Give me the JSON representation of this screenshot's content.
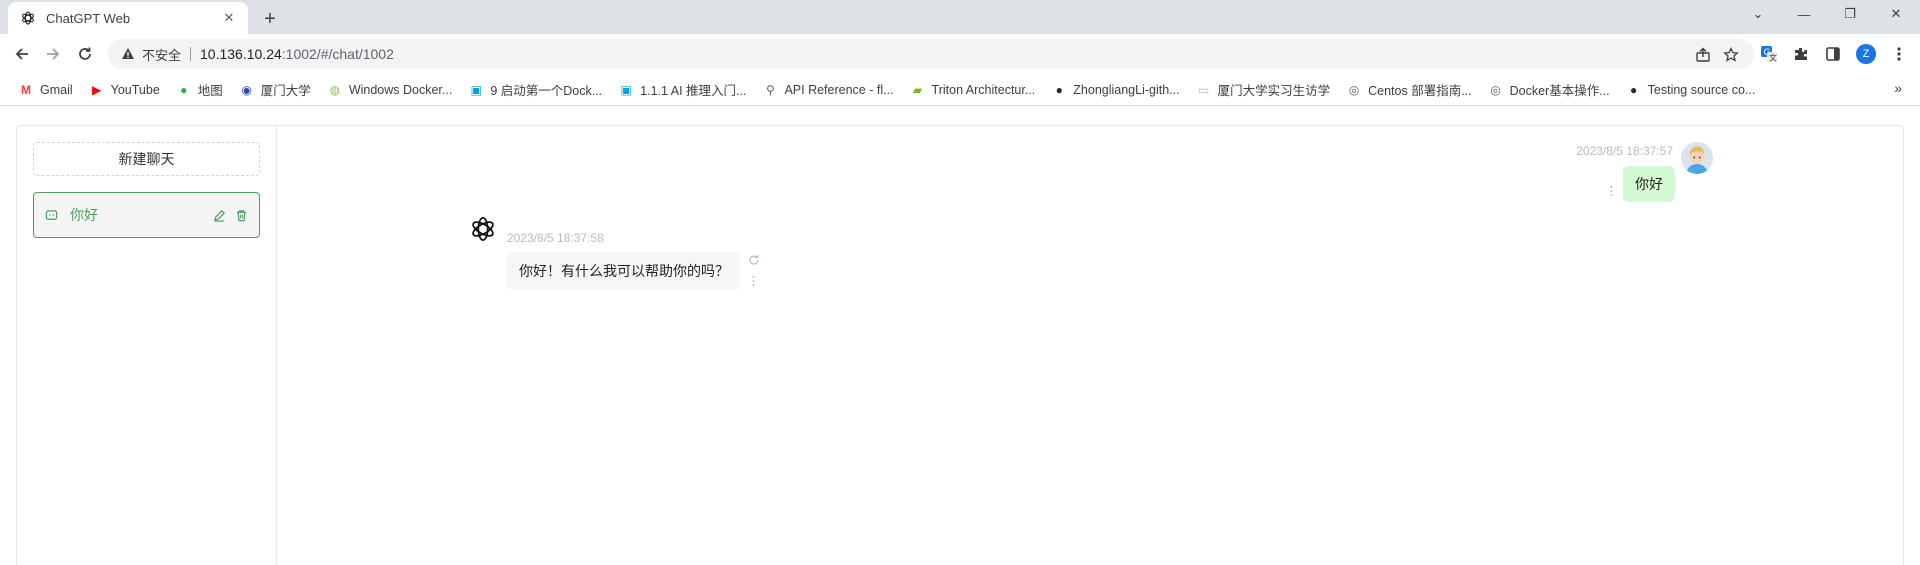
{
  "browser": {
    "tab": {
      "title": "ChatGPT Web",
      "close_glyph": "✕",
      "favicon": "openai-icon"
    },
    "new_tab_glyph": "+",
    "window_controls": {
      "collapse": "⌄",
      "minimize": "—",
      "restore": "❐",
      "close": "✕"
    },
    "address": {
      "security_label": "不安全",
      "host": "10.136.10.24",
      "path": ":1002/#/chat/1002"
    },
    "profile_initial": "Z",
    "bookmarks": [
      {
        "label": "Gmail",
        "icon": "gmail-icon",
        "color": "#ea4335"
      },
      {
        "label": "YouTube",
        "icon": "youtube-icon",
        "color": "#ff0000"
      },
      {
        "label": "地图",
        "icon": "maps-icon",
        "color": "#34a853"
      },
      {
        "label": "厦门大学",
        "icon": "xmu-icon",
        "color": "#2c4aa8"
      },
      {
        "label": "Windows Docker...",
        "icon": "docker-icon",
        "color": "#8bc34a"
      },
      {
        "label": "9 启动第一个Dock...",
        "icon": "bilibili-icon",
        "color": "#00a1d6"
      },
      {
        "label": "1.1.1 AI 推理入门...",
        "icon": "bilibili-icon",
        "color": "#00a1d6"
      },
      {
        "label": "API Reference - fl...",
        "icon": "pin-icon",
        "color": "#5f6368"
      },
      {
        "label": "Triton Architectur...",
        "icon": "nvidia-icon",
        "color": "#76b900"
      },
      {
        "label": "ZhongliangLi-gith...",
        "icon": "github-icon",
        "color": "#24292f"
      },
      {
        "label": "厦门大学实习生访学",
        "icon": "page-icon",
        "color": "#bdbdbd"
      },
      {
        "label": "Centos 部署指南...",
        "icon": "globe-icon",
        "color": "#5f6368"
      },
      {
        "label": "Docker基本操作...",
        "icon": "globe-icon",
        "color": "#5f6368"
      },
      {
        "label": "Testing source co...",
        "icon": "github-icon",
        "color": "#24292f"
      }
    ],
    "bookmarks_more": "»"
  },
  "app": {
    "accent": "#4b9e5f",
    "sidebar": {
      "new_chat_label": "新建聊天",
      "chats": [
        {
          "title": "你好",
          "active": true
        }
      ]
    },
    "messages": [
      {
        "role": "user",
        "time": "2023/8/5 18:37:57",
        "text": "你好",
        "bubble_color": "#d2f9d1"
      },
      {
        "role": "assistant",
        "time": "2023/8/5 18:37:58",
        "text": "你好！有什么我可以帮助你的吗？",
        "bubble_color": "#f4f6f8"
      }
    ]
  }
}
